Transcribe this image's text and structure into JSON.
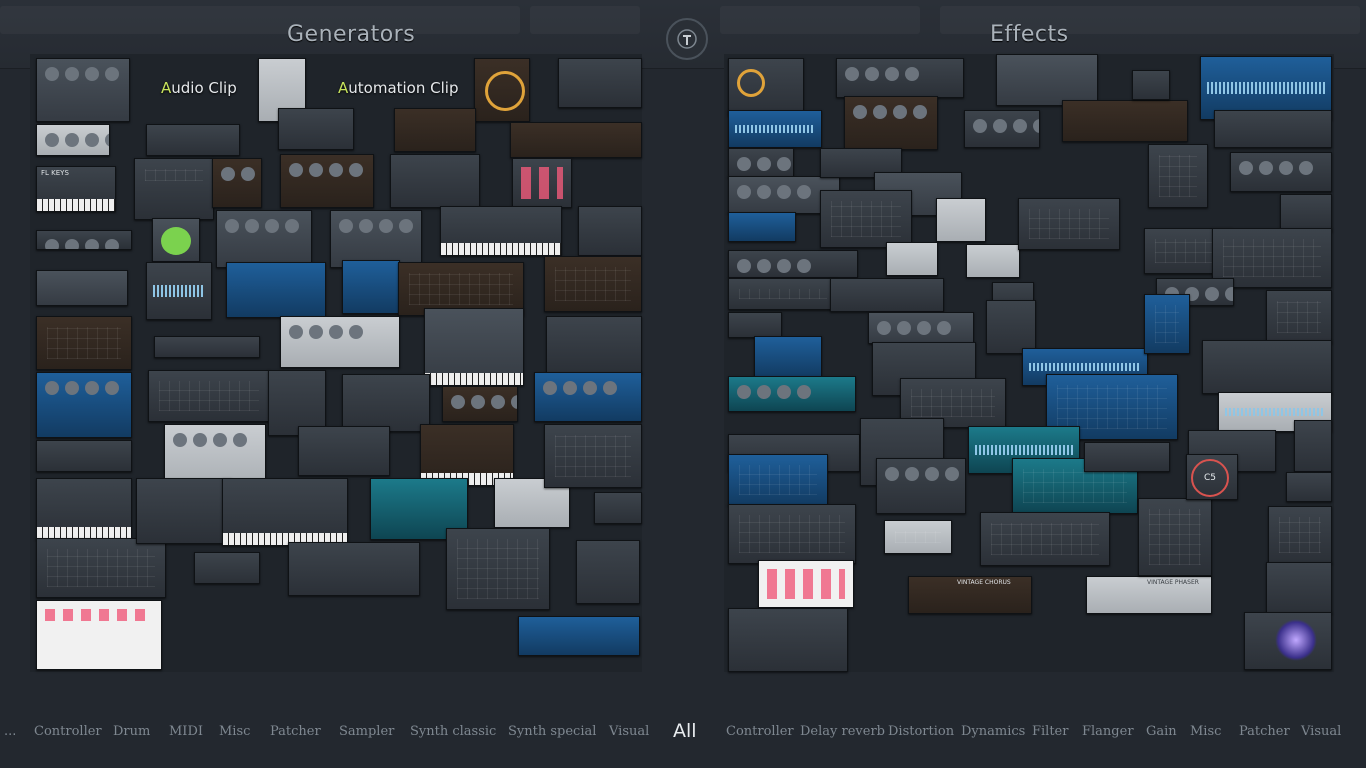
{
  "sections": {
    "generators_title": "Generators",
    "effects_title": "Effects"
  },
  "clips": {
    "audio": {
      "first": "A",
      "rest": "udio Clip"
    },
    "automation": {
      "first": "A",
      "rest": "utomation Clip"
    }
  },
  "thumb_text": {
    "fl_keys": "FL KEYS",
    "c5": "C5",
    "vintage_chorus": "VINTAGE CHORUS",
    "vintage_phaser": "VINTAGE PHASER"
  },
  "tabs": {
    "ellipsis": "...",
    "generators": [
      "Controller",
      "Drum",
      "MIDI",
      "Misc",
      "Patcher",
      "Sampler",
      "Synth classic",
      "Synth special",
      "Visual"
    ],
    "all": "All",
    "effects": [
      "Controller",
      "Delay reverb",
      "Distortion",
      "Dynamics",
      "Filter",
      "Flanger",
      "Gain",
      "Misc",
      "Patcher",
      "Visual"
    ]
  },
  "colors": {
    "accent_green": "#c7e35c",
    "background": "#23282f",
    "active_tab": "#e8ecef"
  },
  "icons": {
    "logo": "fruit-logo-icon"
  }
}
